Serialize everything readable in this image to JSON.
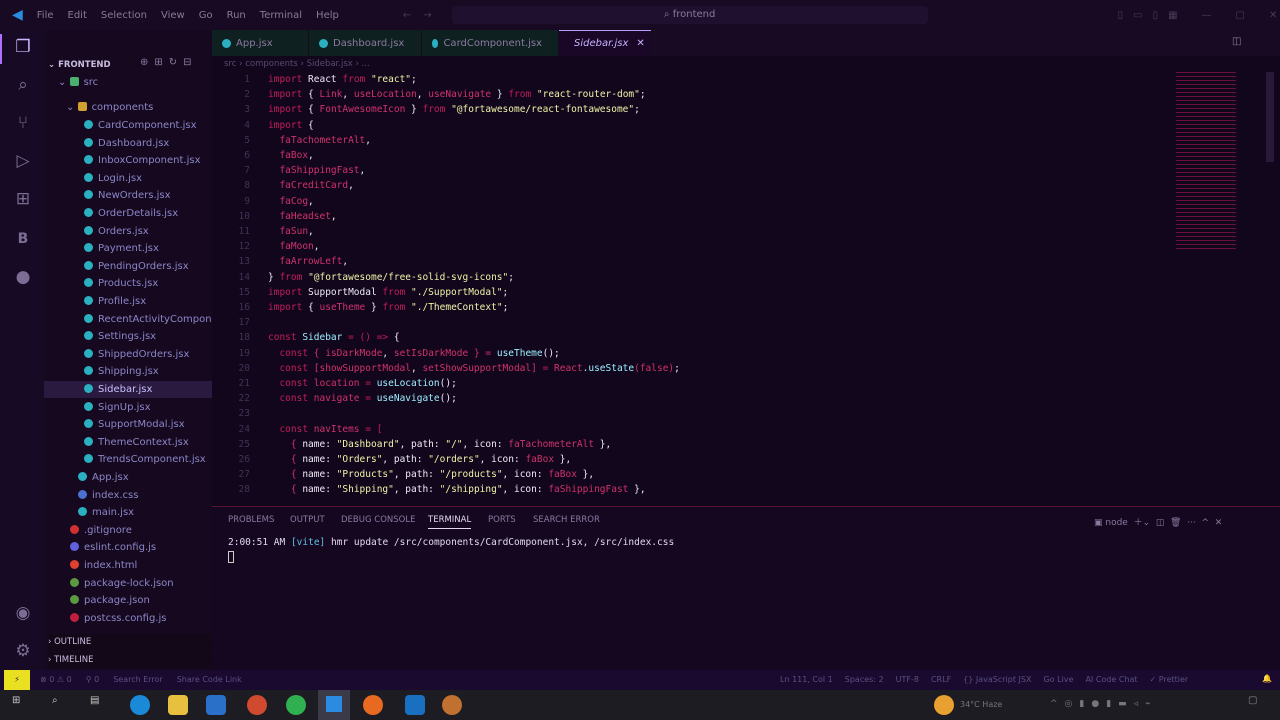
{
  "titlebar": {
    "menu": [
      "File",
      "Edit",
      "Selection",
      "View",
      "Go",
      "Run",
      "Terminal",
      "Help"
    ],
    "search": "frontend"
  },
  "explorer": {
    "title": "FRONTEND",
    "root": "src",
    "folder": "components",
    "files": [
      "CardComponent.jsx",
      "Dashboard.jsx",
      "InboxComponent.jsx",
      "Login.jsx",
      "NewOrders.jsx",
      "OrderDetails.jsx",
      "Orders.jsx",
      "Payment.jsx",
      "PendingOrders.jsx",
      "Products.jsx",
      "Profile.jsx",
      "RecentActivityCompon...",
      "Settings.jsx",
      "ShippedOrders.jsx",
      "Shipping.jsx",
      "Sidebar.jsx",
      "SignUp.jsx",
      "SupportModal.jsx",
      "ThemeContext.jsx",
      "TrendsComponent.jsx"
    ],
    "root_files": [
      {
        "name": "App.jsx",
        "color": "#2ab0c0"
      },
      {
        "name": "index.css",
        "color": "#4a70d0"
      },
      {
        "name": "main.jsx",
        "color": "#2ab0c0"
      }
    ],
    "project_files": [
      {
        "name": ".gitignore",
        "color": "#d03030"
      },
      {
        "name": "eslint.config.js",
        "color": "#6060e0"
      },
      {
        "name": "index.html",
        "color": "#e04030"
      },
      {
        "name": "package-lock.json",
        "color": "#5a9a40"
      },
      {
        "name": "package.json",
        "color": "#5a9a40"
      },
      {
        "name": "postcss.config.js",
        "color": "#c02040"
      }
    ],
    "selected": "Sidebar.jsx",
    "outline": "OUTLINE",
    "timeline": "TIMELINE"
  },
  "tabs": [
    {
      "label": "App.jsx"
    },
    {
      "label": "Dashboard.jsx"
    },
    {
      "label": "CardComponent.jsx"
    },
    {
      "label": "Sidebar.jsx",
      "active": true
    }
  ],
  "breadcrumb": [
    "src",
    "components",
    "Sidebar.jsx",
    "..."
  ],
  "code": [
    [
      [
        "import ",
        "k"
      ],
      [
        "React ",
        "w"
      ],
      [
        "from ",
        "k"
      ],
      [
        "\"react\"",
        "s"
      ],
      [
        ";",
        "w"
      ]
    ],
    [
      [
        "import ",
        "k"
      ],
      [
        "{ ",
        "w"
      ],
      [
        "Link",
        "i"
      ],
      [
        ", ",
        "w"
      ],
      [
        "useLocation",
        "i"
      ],
      [
        ", ",
        "w"
      ],
      [
        "useNavigate",
        "i"
      ],
      [
        " } ",
        "w"
      ],
      [
        "from ",
        "k"
      ],
      [
        "\"react-router-dom\"",
        "s"
      ],
      [
        ";",
        "w"
      ]
    ],
    [
      [
        "import ",
        "k"
      ],
      [
        "{ ",
        "w"
      ],
      [
        "FontAwesomeIcon",
        "i"
      ],
      [
        " } ",
        "w"
      ],
      [
        "from ",
        "k"
      ],
      [
        "\"@fortawesome/react-fontawesome\"",
        "s"
      ],
      [
        ";",
        "w"
      ]
    ],
    [
      [
        "import ",
        "k"
      ],
      [
        "{",
        "w"
      ]
    ],
    [
      [
        "  faTachometerAlt",
        "i"
      ],
      [
        ",",
        "w"
      ]
    ],
    [
      [
        "  faBox",
        "i"
      ],
      [
        ",",
        "w"
      ]
    ],
    [
      [
        "  faShippingFast",
        "i"
      ],
      [
        ",",
        "w"
      ]
    ],
    [
      [
        "  faCreditCard",
        "i"
      ],
      [
        ",",
        "w"
      ]
    ],
    [
      [
        "  faCog",
        "i"
      ],
      [
        ",",
        "w"
      ]
    ],
    [
      [
        "  faHeadset",
        "i"
      ],
      [
        ",",
        "w"
      ]
    ],
    [
      [
        "  faSun",
        "i"
      ],
      [
        ",",
        "w"
      ]
    ],
    [
      [
        "  faMoon",
        "i"
      ],
      [
        ",",
        "w"
      ]
    ],
    [
      [
        "  faArrowLeft",
        "i"
      ],
      [
        ",",
        "w"
      ]
    ],
    [
      [
        "} ",
        "w"
      ],
      [
        "from ",
        "k"
      ],
      [
        "\"@fortawesome/free-solid-svg-icons\"",
        "s"
      ],
      [
        ";",
        "w"
      ]
    ],
    [
      [
        "import ",
        "k"
      ],
      [
        "SupportModal ",
        "w"
      ],
      [
        "from ",
        "k"
      ],
      [
        "\"./SupportModal\"",
        "s"
      ],
      [
        ";",
        "w"
      ]
    ],
    [
      [
        "import ",
        "k"
      ],
      [
        "{ ",
        "w"
      ],
      [
        "useTheme",
        "i"
      ],
      [
        " } ",
        "w"
      ],
      [
        "from ",
        "k"
      ],
      [
        "\"./ThemeContext\"",
        "s"
      ],
      [
        ";",
        "w"
      ]
    ],
    [],
    [
      [
        "const ",
        "k"
      ],
      [
        "Sidebar",
        "f"
      ],
      [
        " = () => ",
        "k"
      ],
      [
        "{",
        "w"
      ]
    ],
    [
      [
        "  const ",
        "k"
      ],
      [
        "{ ",
        "i"
      ],
      [
        "isDarkMode",
        "i"
      ],
      [
        ", ",
        "w"
      ],
      [
        "setIsDarkMode",
        "i"
      ],
      [
        " } = ",
        "i"
      ],
      [
        "useTheme",
        "f"
      ],
      [
        "();",
        "w"
      ]
    ],
    [
      [
        "  const ",
        "k"
      ],
      [
        "[showSupportModal",
        "i"
      ],
      [
        ", ",
        "w"
      ],
      [
        "setShowSupportModal]",
        "i"
      ],
      [
        " = ",
        "k"
      ],
      [
        "React",
        "i"
      ],
      [
        ".useState",
        "f"
      ],
      [
        "(false)",
        "i"
      ],
      [
        ";",
        "w"
      ]
    ],
    [
      [
        "  const ",
        "k"
      ],
      [
        "location ",
        "i"
      ],
      [
        "= ",
        "k"
      ],
      [
        "useLocation",
        "f"
      ],
      [
        "();",
        "w"
      ]
    ],
    [
      [
        "  const ",
        "k"
      ],
      [
        "navigate ",
        "i"
      ],
      [
        "= ",
        "k"
      ],
      [
        "useNavigate",
        "f"
      ],
      [
        "();",
        "w"
      ]
    ],
    [],
    [
      [
        "  const ",
        "k"
      ],
      [
        "navItems ",
        "i"
      ],
      [
        "= [",
        "k"
      ]
    ],
    [
      [
        "    { ",
        "i"
      ],
      [
        "name: ",
        "w"
      ],
      [
        "\"Dashboard\"",
        "s"
      ],
      [
        ", path: ",
        "w"
      ],
      [
        "\"/\"",
        "s"
      ],
      [
        ", icon: ",
        "w"
      ],
      [
        "faTachometerAlt",
        "i"
      ],
      [
        " },",
        "w"
      ]
    ],
    [
      [
        "    { ",
        "i"
      ],
      [
        "name: ",
        "w"
      ],
      [
        "\"Orders\"",
        "s"
      ],
      [
        ", path: ",
        "w"
      ],
      [
        "\"/orders\"",
        "s"
      ],
      [
        ", icon: ",
        "w"
      ],
      [
        "faBox",
        "i"
      ],
      [
        " },",
        "w"
      ]
    ],
    [
      [
        "    { ",
        "i"
      ],
      [
        "name: ",
        "w"
      ],
      [
        "\"Products\"",
        "s"
      ],
      [
        ", path: ",
        "w"
      ],
      [
        "\"/products\"",
        "s"
      ],
      [
        ", icon: ",
        "w"
      ],
      [
        "faBox",
        "i"
      ],
      [
        " },",
        "w"
      ]
    ],
    [
      [
        "    { ",
        "i"
      ],
      [
        "name: ",
        "w"
      ],
      [
        "\"Shipping\"",
        "s"
      ],
      [
        ", path: ",
        "w"
      ],
      [
        "\"/shipping\"",
        "s"
      ],
      [
        ", icon: ",
        "w"
      ],
      [
        "faShippingFast",
        "i"
      ],
      [
        " },",
        "w"
      ]
    ]
  ],
  "panel": {
    "tabs": [
      "PROBLEMS",
      "OUTPUT",
      "DEBUG CONSOLE",
      "TERMINAL",
      "PORTS",
      "SEARCH ERROR"
    ],
    "active": "TERMINAL",
    "shell": "node",
    "terminal_time": "2:00:51 AM",
    "terminal_tag": "[vite]",
    "terminal_msg": "hmr update /src/components/CardComponent.jsx, /src/index.css"
  },
  "status": {
    "left": [
      "⊗ 0 ⚠ 0",
      "⚲ 0",
      "Search Error",
      "Share Code Link"
    ],
    "right": [
      "Ln 111, Col 1",
      "Spaces: 2",
      "UTF-8",
      "CRLF",
      "{} JavaScript JSX",
      "Go Live",
      "AI Code Chat",
      "✓ Prettier"
    ]
  },
  "taskbar": {
    "weather": "34°C Haze"
  }
}
